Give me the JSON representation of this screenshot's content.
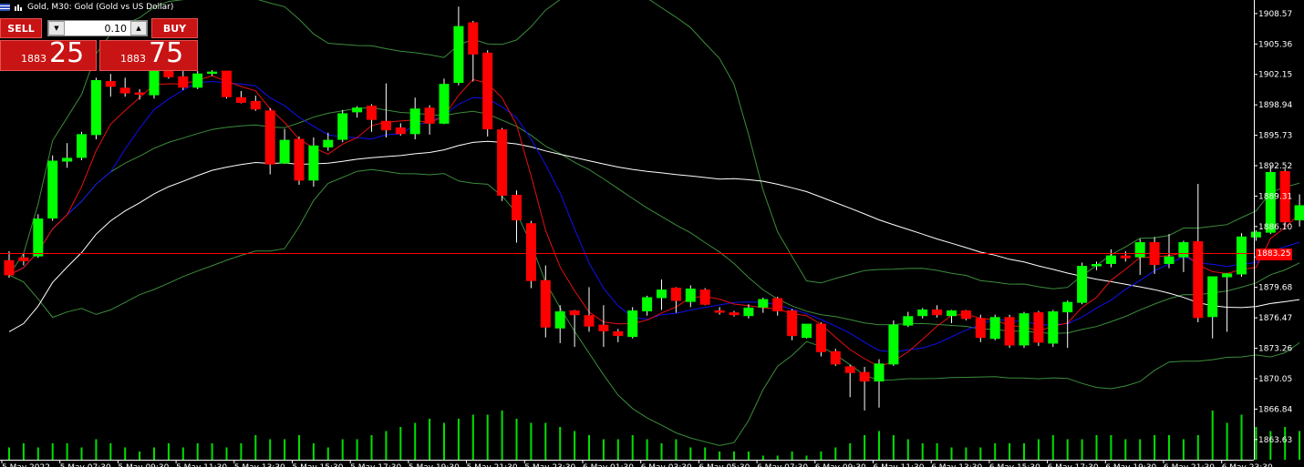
{
  "header": {
    "symbol": "Gold",
    "timeframe_text": "Gold, M30:  Gold (Gold vs US Dollar)"
  },
  "trade_panel": {
    "sell_label": "SELL",
    "buy_label": "BUY",
    "lot_value": "0.10",
    "sell_price_prefix": "1883",
    "sell_price_big": "25",
    "buy_price_prefix": "1883",
    "buy_price_big": "75"
  },
  "current_price_label": "1883.25",
  "colors": {
    "bull": "#00ff00",
    "bear": "#ff0000",
    "volume": "#00e000",
    "bands": "#3c8c3c",
    "red_ma": "#e81010",
    "blue_ma": "#1010f0",
    "white_ma": "#ffffff"
  },
  "chart_data": {
    "type": "candlestick",
    "y_axis": {
      "min": 1861.5,
      "max": 1910,
      "ticks": [
        "1908.57",
        "1905.36",
        "1902.15",
        "1898.94",
        "1895.73",
        "1892.52",
        "1889.31",
        "1886.10",
        "1882.89",
        "1879.68",
        "1876.47",
        "1873.26",
        "1870.05",
        "1866.84",
        "1863.63"
      ]
    },
    "x_axis_labels": [
      "5 May 2022",
      "5 May 07:30",
      "5 May 09:30",
      "5 May 11:30",
      "5 May 13:30",
      "5 May 15:30",
      "5 May 17:30",
      "5 May 19:30",
      "5 May 21:30",
      "5 May 23:30",
      "6 May 01:30",
      "6 May 03:30",
      "6 May 05:30",
      "6 May 07:30",
      "6 May 09:30",
      "6 May 11:30",
      "6 May 13:30",
      "6 May 15:30",
      "6 May 17:30",
      "6 May 19:30",
      "6 May 21:30",
      "6 May 23:30"
    ],
    "current_price": 1883.25,
    "candles": [
      [
        1882.5,
        1883.5,
        1880.7,
        1881.0
      ],
      [
        1882.8,
        1883.3,
        1882.0,
        1882.5
      ],
      [
        1883.0,
        1887.4,
        1882.8,
        1886.9
      ],
      [
        1887.0,
        1893.6,
        1886.7,
        1893.0
      ],
      [
        1893.0,
        1894.9,
        1892.3,
        1893.3
      ],
      [
        1893.4,
        1896.1,
        1893.1,
        1895.8
      ],
      [
        1895.8,
        1901.8,
        1895.3,
        1901.5
      ],
      [
        1901.4,
        1902.2,
        1899.8,
        1900.9
      ],
      [
        1900.7,
        1901.8,
        1899.8,
        1900.2
      ],
      [
        1900.2,
        1900.6,
        1899.5,
        1900.1
      ],
      [
        1900.0,
        1903.0,
        1899.6,
        1902.7
      ],
      [
        1902.8,
        1903.0,
        1901.7,
        1901.9
      ],
      [
        1901.9,
        1902.5,
        1900.5,
        1900.8
      ],
      [
        1900.8,
        1902.5,
        1900.6,
        1902.2
      ],
      [
        1902.3,
        1902.6,
        1902.0,
        1902.4
      ],
      [
        1902.5,
        1902.5,
        1899.6,
        1899.8
      ],
      [
        1899.7,
        1900.4,
        1899.1,
        1899.2
      ],
      [
        1899.3,
        1899.9,
        1898.3,
        1898.5
      ],
      [
        1898.3,
        1898.6,
        1891.6,
        1892.7
      ],
      [
        1892.8,
        1896.4,
        1892.7,
        1895.2
      ],
      [
        1895.3,
        1895.6,
        1890.5,
        1891.0
      ],
      [
        1891.0,
        1895.5,
        1890.3,
        1894.6
      ],
      [
        1894.5,
        1896.0,
        1894.1,
        1895.2
      ],
      [
        1895.3,
        1898.4,
        1895.0,
        1898.0
      ],
      [
        1898.2,
        1898.8,
        1897.6,
        1898.6
      ],
      [
        1898.8,
        1899.0,
        1896.1,
        1897.4
      ],
      [
        1897.2,
        1901.2,
        1895.5,
        1896.3
      ],
      [
        1896.5,
        1897.0,
        1895.7,
        1895.9
      ],
      [
        1895.9,
        1899.7,
        1895.3,
        1898.5
      ],
      [
        1898.6,
        1898.9,
        1895.8,
        1897.0
      ],
      [
        1897.0,
        1901.7,
        1896.9,
        1901.1
      ],
      [
        1901.3,
        1909.3,
        1901.0,
        1907.2
      ],
      [
        1907.6,
        1907.8,
        1901.4,
        1904.3
      ],
      [
        1904.4,
        1904.7,
        1895.6,
        1896.4
      ],
      [
        1896.3,
        1896.5,
        1888.8,
        1889.4
      ],
      [
        1889.4,
        1889.9,
        1884.4,
        1886.8
      ],
      [
        1886.4,
        1886.7,
        1879.6,
        1880.4
      ],
      [
        1880.4,
        1882.0,
        1874.4,
        1875.5
      ],
      [
        1875.4,
        1877.8,
        1873.8,
        1877.1
      ],
      [
        1877.2,
        1877.3,
        1873.4,
        1876.8
      ],
      [
        1876.7,
        1879.7,
        1875.0,
        1875.6
      ],
      [
        1875.7,
        1877.8,
        1873.4,
        1875.1
      ],
      [
        1875.0,
        1875.3,
        1873.9,
        1874.6
      ],
      [
        1874.5,
        1877.6,
        1874.3,
        1877.2
      ],
      [
        1877.2,
        1878.8,
        1876.7,
        1878.6
      ],
      [
        1878.6,
        1880.5,
        1877.3,
        1879.4
      ],
      [
        1879.6,
        1879.7,
        1877.0,
        1878.3
      ],
      [
        1878.2,
        1879.9,
        1877.6,
        1879.5
      ],
      [
        1879.4,
        1879.6,
        1877.8,
        1877.9
      ],
      [
        1877.2,
        1877.6,
        1876.8,
        1877.1
      ],
      [
        1877.0,
        1877.2,
        1876.6,
        1876.8
      ],
      [
        1876.7,
        1877.9,
        1876.4,
        1877.5
      ],
      [
        1877.6,
        1878.6,
        1877.0,
        1878.4
      ],
      [
        1878.5,
        1878.7,
        1876.7,
        1877.2
      ],
      [
        1877.2,
        1877.4,
        1874.1,
        1874.6
      ],
      [
        1874.4,
        1875.8,
        1874.3,
        1875.8
      ],
      [
        1875.8,
        1876.0,
        1872.4,
        1872.9
      ],
      [
        1872.9,
        1873.2,
        1871.4,
        1871.6
      ],
      [
        1871.3,
        1871.5,
        1868.1,
        1870.7
      ],
      [
        1870.7,
        1871.3,
        1866.7,
        1869.8
      ],
      [
        1869.8,
        1872.1,
        1867.0,
        1871.6
      ],
      [
        1871.6,
        1876.2,
        1871.4,
        1875.7
      ],
      [
        1875.7,
        1877.1,
        1875.5,
        1876.6
      ],
      [
        1876.7,
        1877.5,
        1876.4,
        1877.3
      ],
      [
        1877.3,
        1877.8,
        1876.5,
        1876.8
      ],
      [
        1876.7,
        1877.3,
        1875.9,
        1877.2
      ],
      [
        1877.2,
        1877.3,
        1876.2,
        1876.4
      ],
      [
        1876.4,
        1876.8,
        1873.9,
        1874.4
      ],
      [
        1874.3,
        1876.8,
        1874.1,
        1876.5
      ],
      [
        1876.5,
        1876.8,
        1873.3,
        1873.6
      ],
      [
        1873.6,
        1877.1,
        1873.3,
        1876.9
      ],
      [
        1877.0,
        1877.2,
        1873.5,
        1873.9
      ],
      [
        1873.8,
        1877.3,
        1873.4,
        1877.1
      ],
      [
        1877.1,
        1878.3,
        1873.3,
        1878.1
      ],
      [
        1878.1,
        1882.3,
        1877.9,
        1881.9
      ],
      [
        1882.0,
        1882.4,
        1881.5,
        1882.1
      ],
      [
        1882.2,
        1883.7,
        1881.8,
        1883.0
      ],
      [
        1883.0,
        1883.5,
        1882.4,
        1882.8
      ],
      [
        1882.9,
        1884.8,
        1881.0,
        1884.4
      ],
      [
        1884.4,
        1885.0,
        1881.1,
        1882.1
      ],
      [
        1882.2,
        1885.3,
        1881.7,
        1882.9
      ],
      [
        1882.9,
        1884.6,
        1881.3,
        1884.4
      ],
      [
        1884.5,
        1890.6,
        1876.0,
        1876.5
      ],
      [
        1876.6,
        1880.4,
        1874.3,
        1880.8
      ],
      [
        1880.8,
        1881.2,
        1875.0,
        1881.1
      ],
      [
        1881.1,
        1885.4,
        1880.8,
        1885.0
      ],
      [
        1885.0,
        1885.7,
        1884.6,
        1885.5
      ],
      [
        1885.5,
        1892.5,
        1885.3,
        1891.8
      ],
      [
        1891.9,
        1892.2,
        1886.2,
        1886.6
      ],
      [
        1886.8,
        1889.5,
        1886.1,
        1888.3
      ]
    ],
    "volumes": [
      3,
      4,
      3,
      4,
      4,
      3,
      5,
      4,
      3,
      2,
      3,
      4,
      3,
      4,
      4,
      3,
      4,
      6,
      5,
      5,
      6,
      4,
      3,
      5,
      5,
      6,
      7,
      8,
      9,
      10,
      9,
      10,
      11,
      11,
      12,
      10,
      9,
      9,
      8,
      7,
      6,
      5,
      5,
      6,
      5,
      4,
      5,
      3,
      3,
      2,
      2,
      2,
      1,
      1,
      2,
      1,
      2,
      3,
      4,
      6,
      7,
      6,
      5,
      4,
      4,
      3,
      3,
      3,
      4,
      4,
      4,
      5,
      6,
      5,
      5,
      6,
      6,
      5,
      5,
      6,
      6,
      5,
      6,
      12,
      9,
      11,
      8,
      7,
      8,
      7,
      6,
      2
    ],
    "series": [
      {
        "kind": "ma-fast-red"
      },
      {
        "kind": "ma-blue"
      },
      {
        "kind": "ma-white"
      },
      {
        "kind": "bollinger"
      }
    ]
  }
}
